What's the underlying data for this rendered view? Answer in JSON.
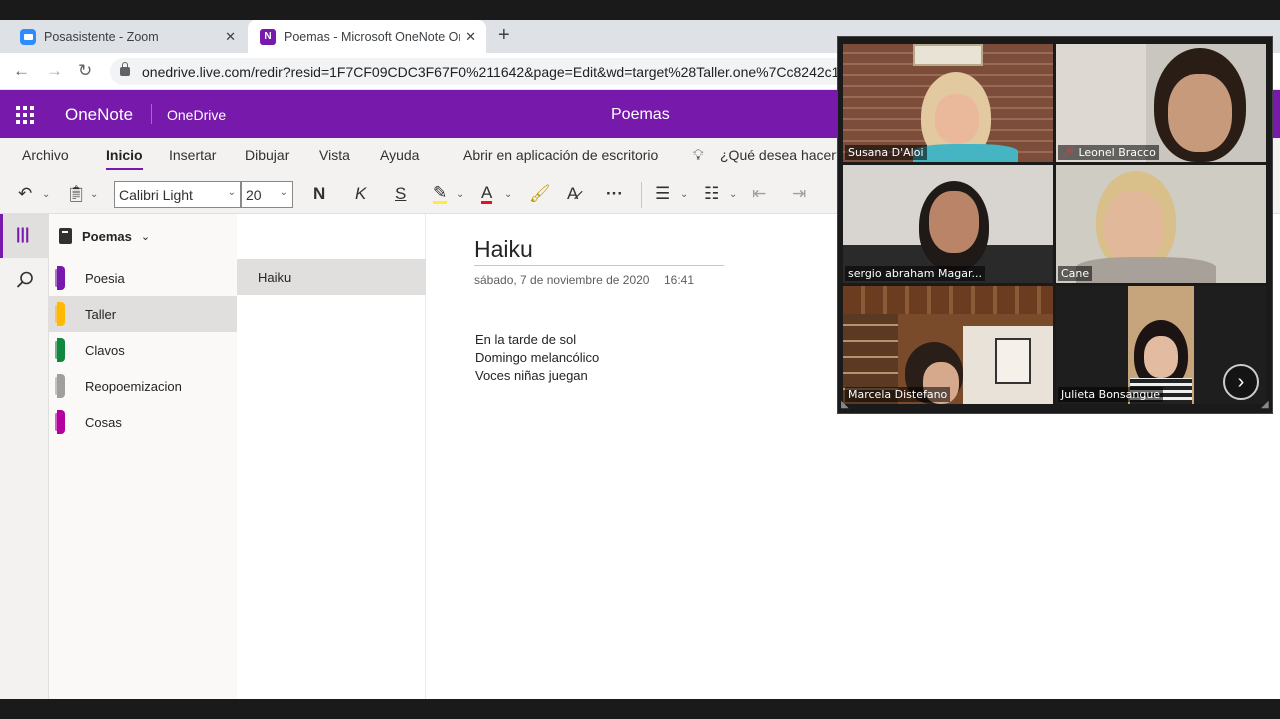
{
  "browser": {
    "tabs": [
      {
        "title": "Posasistente - Zoom"
      },
      {
        "title": "Poemas - Microsoft OneNote Or"
      }
    ],
    "url": "onedrive.live.com/redir?resid=1F7CF09CDC3F67F0%211642&page=Edit&wd=target%28Taller.one%7Cc8242c14-"
  },
  "header": {
    "app": "OneNote",
    "service": "OneDrive",
    "document_title": "Poemas"
  },
  "ribbon": {
    "tabs": [
      "Archivo",
      "Inicio",
      "Insertar",
      "Dibujar",
      "Vista",
      "Ayuda"
    ],
    "active_tab": "Inicio",
    "open_desktop": "Abrir en aplicación de escritorio",
    "tell_me": "¿Qué desea hacer?"
  },
  "toolbar": {
    "font": "Calibri Light",
    "size": "20",
    "bold": "N",
    "italic": "K",
    "underline": "S",
    "more": "···"
  },
  "notebook": {
    "name": "Poemas",
    "sections": [
      {
        "label": "Poesia",
        "color": "#7719aa"
      },
      {
        "label": "Taller",
        "color": "#ffb900"
      },
      {
        "label": "Clavos",
        "color": "#10893e"
      },
      {
        "label": "Reopoemizacion",
        "color": "#a19f9d"
      },
      {
        "label": "Cosas",
        "color": "#b4009e"
      }
    ],
    "selected_section": "Taller",
    "pages": [
      "Haiku"
    ]
  },
  "page": {
    "title": "Haiku",
    "date": "sábado, 7 de noviembre de 2020",
    "time": "16:41",
    "lines": [
      "En la tarde de sol",
      "Domingo melancólico",
      "Voces niñas juegan"
    ]
  },
  "zoom": {
    "participants": [
      {
        "name": "Susana D'Aloi",
        "speaking": true
      },
      {
        "name": "Leonel Bracco",
        "muted": true
      },
      {
        "name": "sergio abraham Magar..."
      },
      {
        "name": "Cane"
      },
      {
        "name": "Marcela Distefano"
      },
      {
        "name": "Julieta Bonsangue"
      }
    ]
  }
}
